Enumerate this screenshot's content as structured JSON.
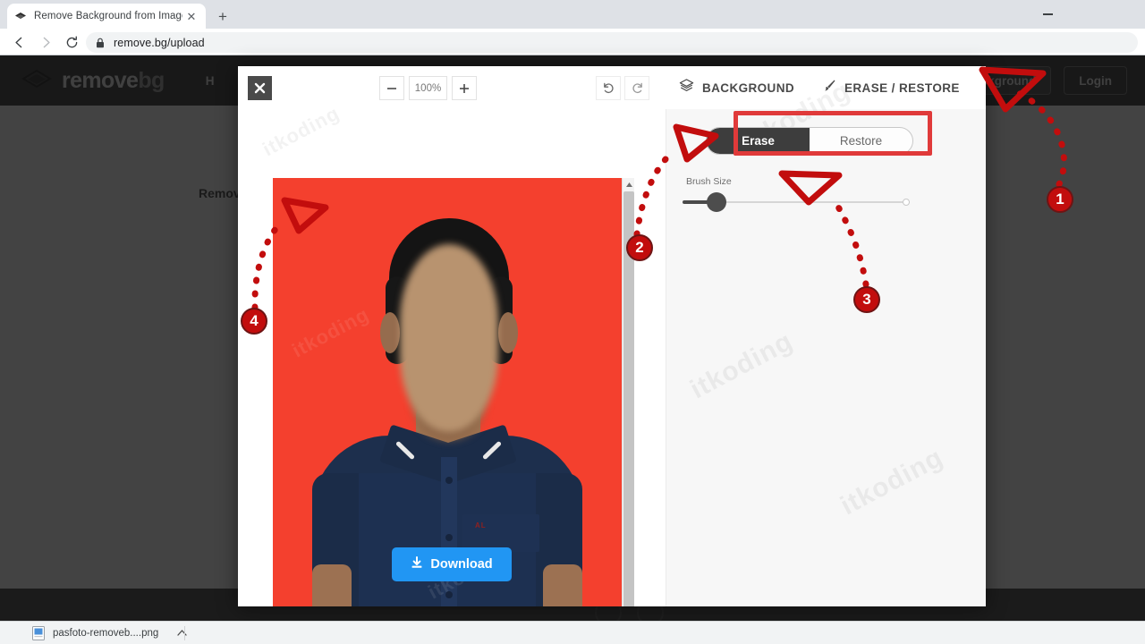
{
  "browser": {
    "tab_title": "Remove Background from Image",
    "tab_favicon": "removebg-diamond-icon",
    "new_tab_label": "+",
    "close_tab_label": "✕",
    "minimize_label": "",
    "url": "remove.bg/upload",
    "back_icon": "arrow-left-icon",
    "forward_icon": "arrow-right-icon",
    "reload_icon": "reload-icon",
    "lock_icon": "lock-icon"
  },
  "site": {
    "logo_remove": "remove",
    "logo_bg": "bg",
    "nav": [
      {
        "label": "H"
      }
    ],
    "actions": {
      "save_background": "Save Background",
      "login": "Login"
    },
    "page_heading": "Remove"
  },
  "editor": {
    "close_label": "✕",
    "zoom": {
      "minus_label": "−",
      "level": "100%",
      "plus_label": "+"
    },
    "history": {
      "undo_icon": "undo-icon",
      "redo_icon": "redo-icon"
    },
    "tabs": [
      {
        "label": "BACKGROUND",
        "icon": "layers-icon",
        "active": false
      },
      {
        "label": "ERASE / RESTORE",
        "icon": "brush-icon",
        "active": true
      }
    ],
    "segments": [
      {
        "label": "Erase",
        "selected": true
      },
      {
        "label": "Restore",
        "selected": false
      }
    ],
    "brush": {
      "label": "Brush Size",
      "value_percent": 13
    },
    "download_label": "Download",
    "download_icon": "download-icon",
    "scrollbar": {
      "up_icon": "triangle-up-icon",
      "down_icon": "triangle-down-icon"
    },
    "photo": {
      "background_color": "#f4402e",
      "shirt_color": "#1d3051",
      "pocket_text": "AL"
    }
  },
  "annotations": {
    "markers": [
      {
        "id": "1",
        "label": "1"
      },
      {
        "id": "2",
        "label": "2"
      },
      {
        "id": "3",
        "label": "3"
      },
      {
        "id": "4",
        "label": "4"
      }
    ],
    "highlight_color": "#e03a3a",
    "marker_color": "#c20d0d"
  },
  "shelf": {
    "file_name": "pasfoto-removeb....png",
    "caret_label": "⌃",
    "file_icon": "image-file-icon"
  },
  "watermark": {
    "text": "itkoding"
  }
}
